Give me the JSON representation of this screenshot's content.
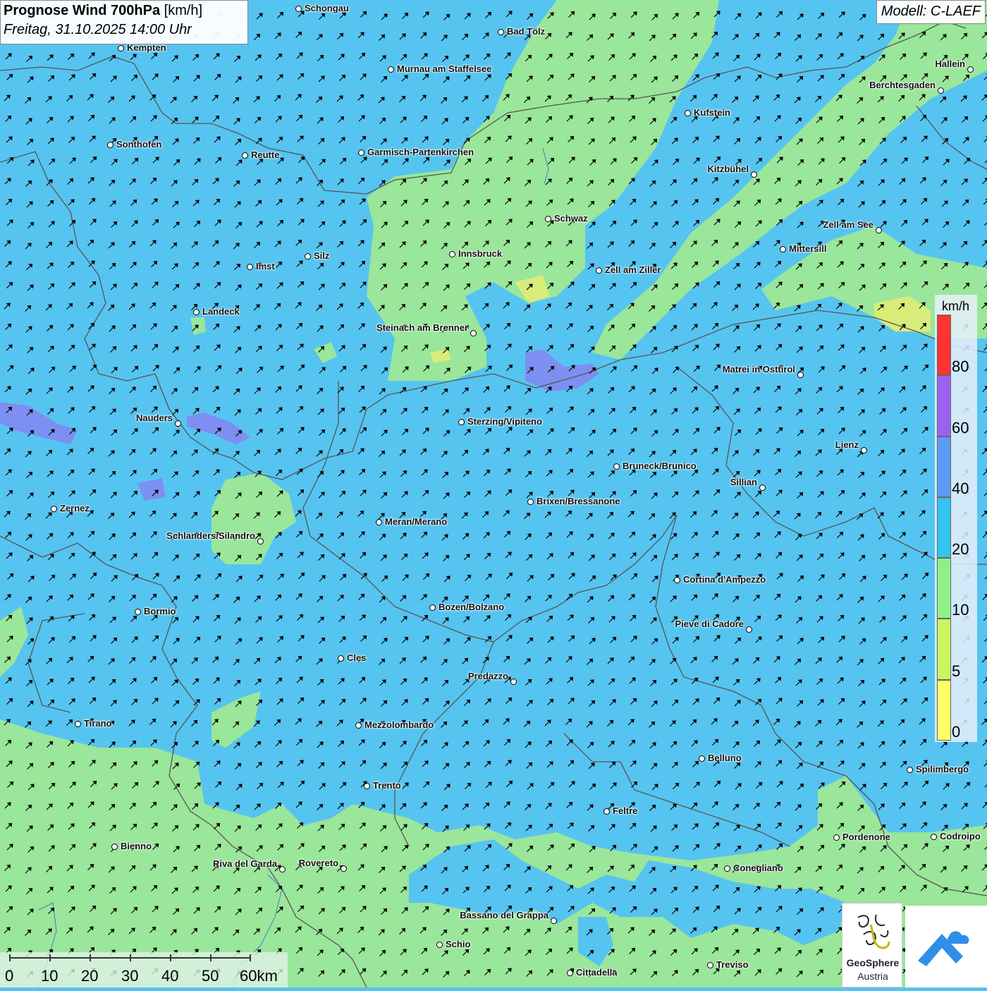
{
  "title": {
    "main_bold": "Prognose Wind 700hPa",
    "main_unit": "[km/h]",
    "subtitle": "Freitag, 31.10.2025 14:00 Uhr"
  },
  "model": "Modell: C-LAEF",
  "legend": {
    "unit": "km/h",
    "classes": [
      {
        "label": "0",
        "from": 0,
        "to": 5,
        "color": "#ffff66"
      },
      {
        "label": "5",
        "from": 5,
        "to": 10,
        "color": "#c8f560"
      },
      {
        "label": "10",
        "from": 10,
        "to": 20,
        "color": "#8ef08a"
      },
      {
        "label": "20",
        "from": 20,
        "to": 40,
        "color": "#33c4ef"
      },
      {
        "label": "40",
        "from": 40,
        "to": 60,
        "color": "#5e9bf7"
      },
      {
        "label": "60",
        "from": 60,
        "to": 80,
        "color": "#9a62ee"
      },
      {
        "label": "80",
        "from": 80,
        "to": null,
        "color": "#ff3333"
      }
    ]
  },
  "scale": {
    "labels": [
      "0",
      "10",
      "20",
      "30",
      "40",
      "50",
      "60km"
    ]
  },
  "wind_direction": "south-west",
  "cities": [
    {
      "name": "Schongau"
    },
    {
      "name": "Bad Tölz"
    },
    {
      "name": "Kempten"
    },
    {
      "name": "Murnau am Staffelsee"
    },
    {
      "name": "Hallein"
    },
    {
      "name": "Berchtesgaden"
    },
    {
      "name": "Kufstein"
    },
    {
      "name": "Sonthofen"
    },
    {
      "name": "Reutte"
    },
    {
      "name": "Garmisch-Partenkirchen"
    },
    {
      "name": "Kitzbühel"
    },
    {
      "name": "Schwaz"
    },
    {
      "name": "Zell am See"
    },
    {
      "name": "Mittersill"
    },
    {
      "name": "Innsbruck"
    },
    {
      "name": "Silz"
    },
    {
      "name": "Imst"
    },
    {
      "name": "Zell am Ziller"
    },
    {
      "name": "Landeck"
    },
    {
      "name": "Steinach am Brenner"
    },
    {
      "name": "Matrei in Osttirol"
    },
    {
      "name": "Nauders"
    },
    {
      "name": "Sterzing/Vipiteno"
    },
    {
      "name": "Lienz"
    },
    {
      "name": "Bruneck/Brunico"
    },
    {
      "name": "Sillian"
    },
    {
      "name": "Zernez"
    },
    {
      "name": "Brixen/Bressanone"
    },
    {
      "name": "Meran/Merano"
    },
    {
      "name": "Schlanders/Silandro"
    },
    {
      "name": "Cortina d'Ampezzo"
    },
    {
      "name": "Bormio"
    },
    {
      "name": "Bozen/Bolzano"
    },
    {
      "name": "Pieve di Cadore"
    },
    {
      "name": "Cles"
    },
    {
      "name": "Predazzo"
    },
    {
      "name": "Tirano"
    },
    {
      "name": "Mezzolombardo"
    },
    {
      "name": "Belluno"
    },
    {
      "name": "Spilimbergo"
    },
    {
      "name": "Trento"
    },
    {
      "name": "Feltre"
    },
    {
      "name": "Bienno"
    },
    {
      "name": "Pordenone"
    },
    {
      "name": "Codroipo"
    },
    {
      "name": "Riva del Garda"
    },
    {
      "name": "Rovereto"
    },
    {
      "name": "Conegliano"
    },
    {
      "name": "Bassano del Grappa"
    },
    {
      "name": "Schio"
    },
    {
      "name": "Treviso"
    },
    {
      "name": "Cittadella"
    }
  ],
  "logos": {
    "geosphere_line1": "GeoSphere",
    "geosphere_line2": "Austria"
  },
  "colors": {
    "background_wind": "#56c4f0",
    "calm_area": "#9ae69a",
    "weak_area": "#d8ec7a",
    "strong_area": "#7d8ff0",
    "borders": "#555555"
  }
}
